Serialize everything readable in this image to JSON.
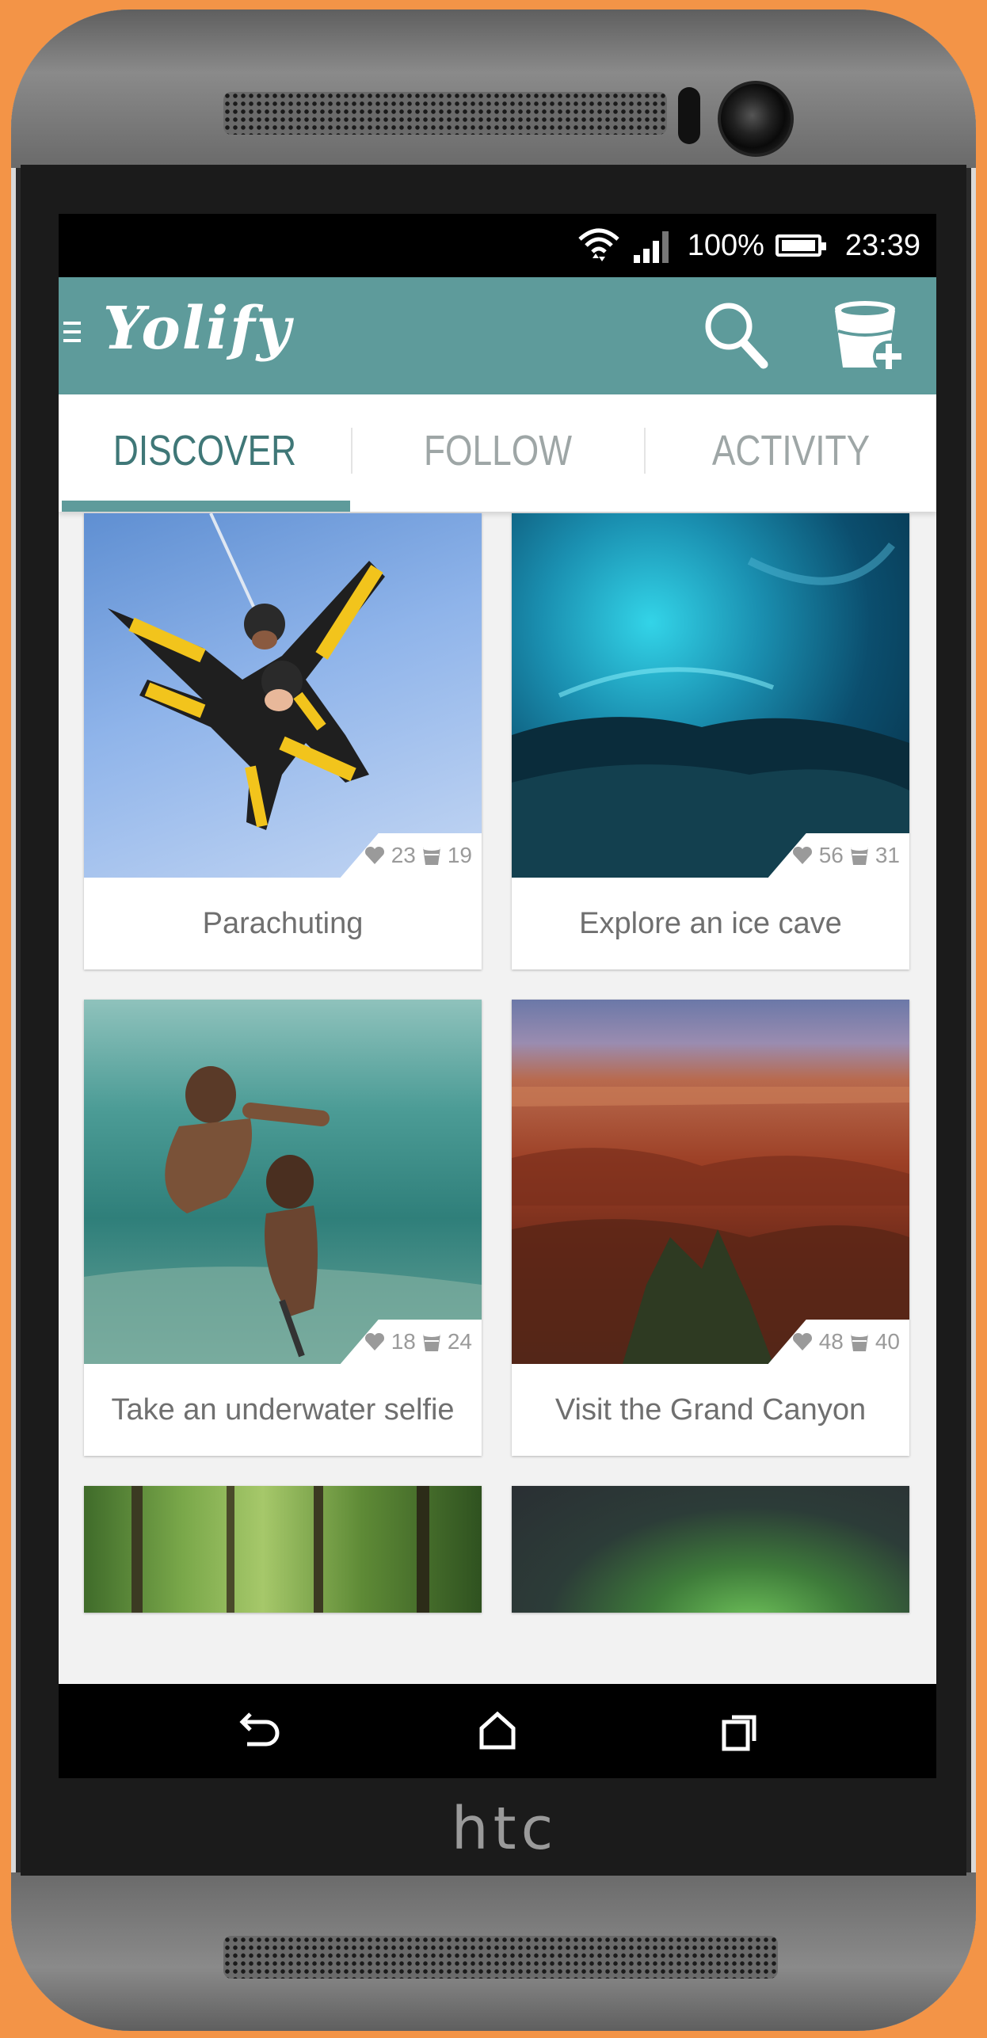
{
  "device": {
    "brand": "htc"
  },
  "status_bar": {
    "battery": "100%",
    "time": "23:39"
  },
  "app_bar": {
    "logo": "Yolify"
  },
  "tabs": [
    {
      "label": "DISCOVER",
      "active": true
    },
    {
      "label": "FOLLOW",
      "active": false
    },
    {
      "label": "ACTIVITY",
      "active": false
    }
  ],
  "cards": [
    {
      "title": "Parachuting",
      "likes": "23",
      "buckets": "19"
    },
    {
      "title": "Explore an ice cave",
      "likes": "56",
      "buckets": "31"
    },
    {
      "title": "Take an underwater selfie",
      "likes": "18",
      "buckets": "24"
    },
    {
      "title": "Visit the Grand Canyon",
      "likes": "48",
      "buckets": "40"
    },
    {
      "title": "",
      "likes": "",
      "buckets": ""
    },
    {
      "title": "",
      "likes": "",
      "buckets": ""
    }
  ],
  "colors": {
    "accent": "#5e9b9b",
    "tab_active": "#3f7777",
    "background": "#f39447"
  },
  "icons": [
    "menu-icon",
    "search-icon",
    "bucket-add-icon",
    "heart-icon",
    "bucket-icon",
    "back-icon",
    "home-icon",
    "recents-icon",
    "wifi-icon",
    "signal-icon",
    "battery-icon"
  ]
}
